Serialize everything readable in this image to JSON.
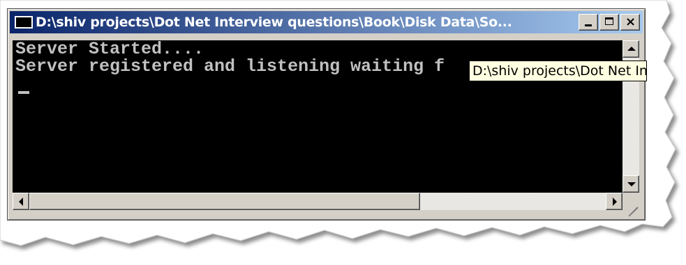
{
  "window": {
    "title": "D:\\shiv projects\\Dot Net Interview questions\\Book\\Disk Data\\So...",
    "icon": "console-app-icon"
  },
  "controls": {
    "minimize": "minimize-icon",
    "maximize": "maximize-icon",
    "close": "×"
  },
  "console": {
    "lines": [
      "Server Started....",
      "Server registered and listening waiting f"
    ],
    "colors": {
      "background": "#000000",
      "text": "#c0c0c0"
    }
  },
  "tooltip": {
    "text": "D:\\shiv projects\\Dot Net In"
  }
}
